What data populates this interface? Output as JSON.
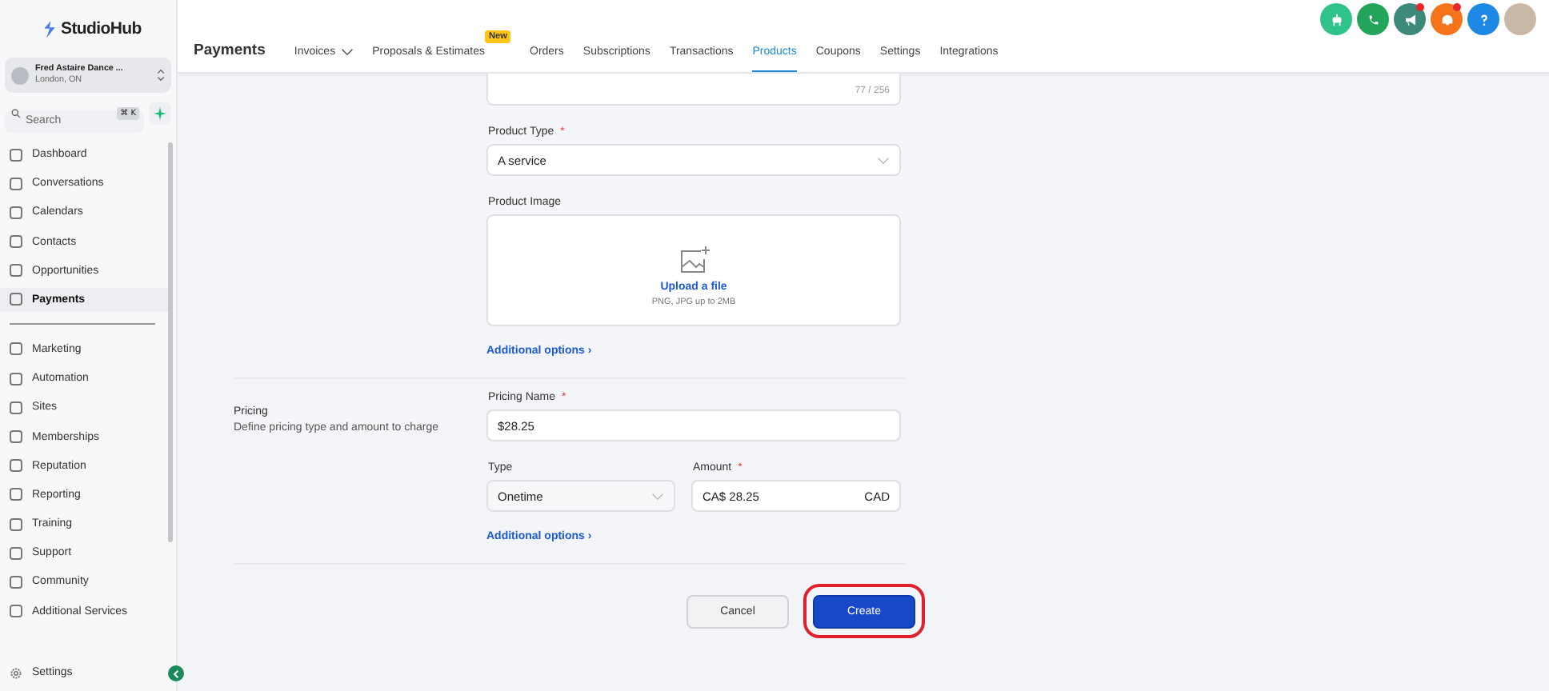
{
  "brand": {
    "name": "StudioHub"
  },
  "account": {
    "name": "Fred Astaire Dance ...",
    "location": "London, ON"
  },
  "search": {
    "placeholder": "Search",
    "shortcut": "⌘ K"
  },
  "sidebar": {
    "sections": [
      {
        "items": [
          {
            "label": "Dashboard",
            "selected": false
          },
          {
            "label": "Conversations",
            "selected": false
          },
          {
            "label": "Calendars",
            "selected": false
          },
          {
            "label": "Contacts",
            "selected": false
          },
          {
            "label": "Opportunities",
            "selected": false
          },
          {
            "label": "Payments",
            "selected": true
          }
        ]
      },
      {
        "items": [
          {
            "label": "Marketing",
            "selected": false
          },
          {
            "label": "Automation",
            "selected": false
          },
          {
            "label": "Sites",
            "selected": false
          },
          {
            "label": "Memberships",
            "selected": false
          },
          {
            "label": "Reputation",
            "selected": false
          },
          {
            "label": "Reporting",
            "selected": false
          },
          {
            "label": "Training",
            "selected": false
          },
          {
            "label": "Support",
            "selected": false
          },
          {
            "label": "Community",
            "selected": false
          },
          {
            "label": "Additional Services",
            "selected": false
          }
        ]
      }
    ],
    "footer": "Settings"
  },
  "header": {
    "title": "Payments",
    "tabs": [
      {
        "label": "Invoices",
        "dropdown": true,
        "selected": false
      },
      {
        "label": "Proposals & Estimates",
        "badge": "New",
        "selected": false
      },
      {
        "label": "Orders",
        "selected": false
      },
      {
        "label": "Subscriptions",
        "selected": false
      },
      {
        "label": "Transactions",
        "selected": false
      },
      {
        "label": "Products",
        "selected": true
      },
      {
        "label": "Coupons",
        "selected": false
      },
      {
        "label": "Settings",
        "selected": false
      },
      {
        "label": "Integrations",
        "selected": false
      }
    ],
    "icons": [
      {
        "kind": "robot",
        "color": "#2fc28a"
      },
      {
        "kind": "phone",
        "color": "#22a55a"
      },
      {
        "kind": "megaphone",
        "color": "#3e8a7a",
        "dot": true
      },
      {
        "kind": "bell",
        "color": "#f5731a",
        "dot": true
      },
      {
        "kind": "help",
        "color": "#1e88e5"
      },
      {
        "kind": "avatar",
        "color": "#c9b8a5"
      }
    ]
  },
  "form": {
    "description_counter": "77 / 256",
    "product_type": {
      "label": "Product Type",
      "required_mark": "*",
      "value": "A service"
    },
    "product_image": {
      "label": "Product Image",
      "upload": "Upload a file",
      "hint": "PNG, JPG up to 2MB"
    },
    "additional_options": "Additional options ›",
    "pricing": {
      "title": "Pricing",
      "subtitle": "Define pricing type and amount to charge",
      "name": {
        "label": "Pricing Name",
        "required_mark": "*",
        "value": "$28.25"
      },
      "type": {
        "label": "Type",
        "value": "Onetime"
      },
      "amount": {
        "label": "Amount",
        "required_mark": "*",
        "value": "CA$ 28.25",
        "currency": "CAD"
      },
      "additional_options": "Additional options ›"
    }
  },
  "buttons": [
    {
      "label": "Cancel",
      "kind": "secondary",
      "highlighted": false
    },
    {
      "label": "Create",
      "kind": "primary",
      "highlighted": true
    }
  ]
}
